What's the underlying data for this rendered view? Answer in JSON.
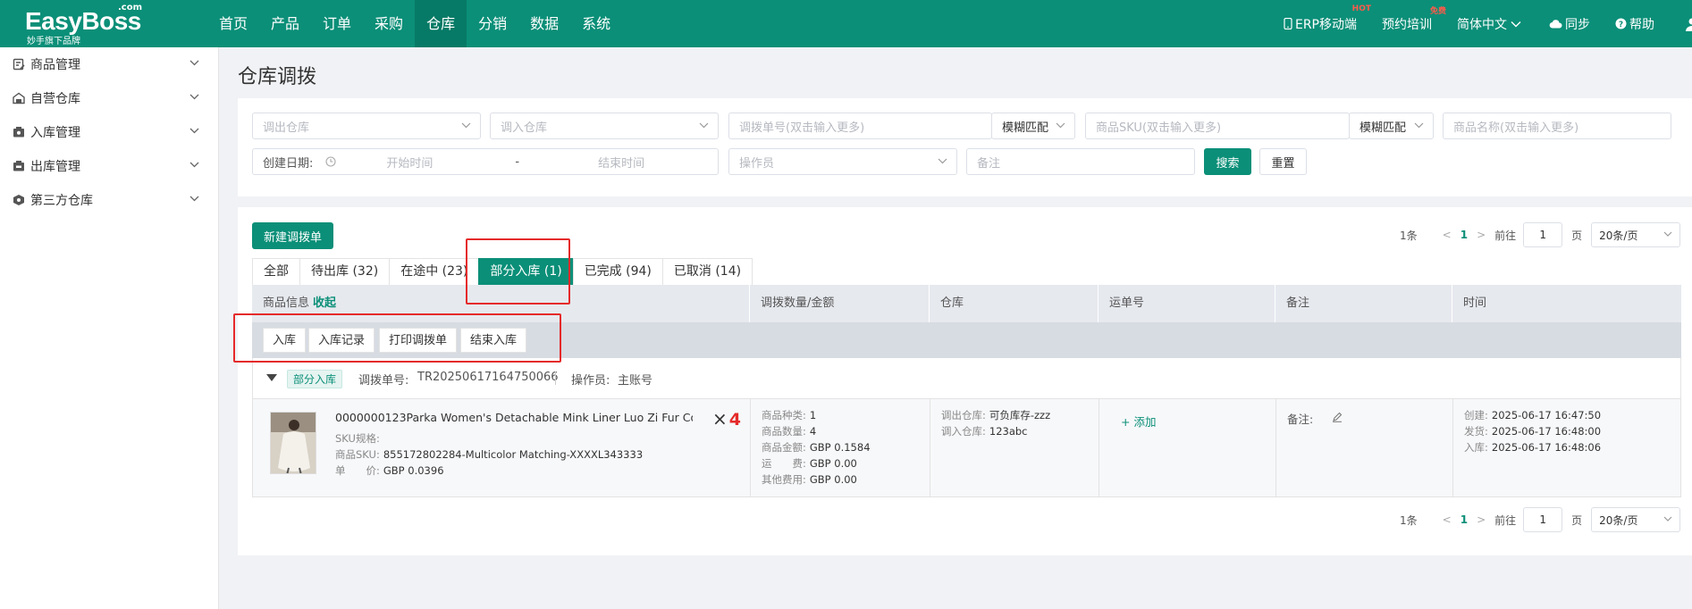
{
  "app": {
    "logo": "EasyBoss",
    "logo_suffix": ".com",
    "logo_sub": "妙手旗下品牌"
  },
  "nav": {
    "items": [
      {
        "label": "首页"
      },
      {
        "label": "产品"
      },
      {
        "label": "订单"
      },
      {
        "label": "采购"
      },
      {
        "label": "仓库",
        "active": true
      },
      {
        "label": "分销"
      },
      {
        "label": "数据"
      },
      {
        "label": "系统"
      }
    ],
    "right": {
      "erp_mobile": "ERP移动端",
      "erp_badge": "HOT",
      "training": "预约培训",
      "training_badge": "免费",
      "language": "简体中文",
      "sync": "同步",
      "help": "帮助"
    }
  },
  "sidebar": {
    "items": [
      {
        "label": "商品管理",
        "icon": "product-icon"
      },
      {
        "label": "自营仓库",
        "icon": "warehouse-icon"
      },
      {
        "label": "入库管理",
        "icon": "inbound-icon"
      },
      {
        "label": "出库管理",
        "icon": "outbound-icon"
      },
      {
        "label": "第三方仓库",
        "icon": "third-party-icon"
      }
    ]
  },
  "page": {
    "title": "仓库调拨"
  },
  "filters": {
    "out_warehouse": "调出仓库",
    "in_warehouse": "调入仓库",
    "transfer_no": "调拨单号(双击输入更多)",
    "transfer_match": "模糊匹配",
    "sku": "商品SKU(双击输入更多)",
    "sku_match": "模糊匹配",
    "product_name": "商品名称(双击输入更多)",
    "created_label": "创建日期:",
    "start_time": "开始时间",
    "date_sep": "-",
    "end_time": "结束时间",
    "operator": "操作员",
    "remark": "备注",
    "search_btn": "搜索",
    "reset_btn": "重置"
  },
  "list": {
    "new_btn": "新建调拨单",
    "tabs": [
      {
        "label": "全部"
      },
      {
        "label": "待出库 (32)"
      },
      {
        "label": "在途中 (23)"
      },
      {
        "label": "部分入库 (1)",
        "active": true
      },
      {
        "label": "已完成 (94)"
      },
      {
        "label": "已取消 (14)"
      }
    ],
    "columns": {
      "product": "商品信息",
      "collapse": "收起",
      "qty_amount": "调拨数量/金额",
      "warehouse": "仓库",
      "tracking": "运单号",
      "remark": "备注",
      "time": "时间"
    },
    "actions": [
      "入库",
      "入库记录",
      "打印调拨单",
      "结束入库"
    ],
    "pager": {
      "total": "1条",
      "prev": "<",
      "page": "1",
      "next": ">",
      "goto": "前往",
      "goto_value": "1",
      "page_unit": "页",
      "page_size": "20条/页"
    },
    "orders": [
      {
        "status": "部分入库",
        "transfer_no_label": "调拨单号:",
        "transfer_no": "TR20250617164750066",
        "operator_label": "操作员:",
        "operator": "主账号",
        "product": {
          "title": "0000000123Parka Women's Detachable Mink Liner Luo Zi Fur Co…",
          "sku_spec_label": "SKU规格:",
          "sku_spec": "",
          "sku_label": "商品SKU:",
          "sku": "855172802284-Multicolor Matching-XXXXL343333",
          "unit_price_label": "单　　价:",
          "unit_price": "GBP 0.0396",
          "multiplier_symbol": "×",
          "multiplier": "4"
        },
        "qty": {
          "kinds_label": "商品种类:",
          "kinds": "1",
          "count_label": "商品数量:",
          "count": "4",
          "amount_label": "商品金额:",
          "amount": "GBP 0.1584",
          "freight_label": "运　　费:",
          "freight": "GBP 0.00",
          "other_label": "其他费用:",
          "other": "GBP 0.00"
        },
        "warehouse": {
          "out_label": "调出仓库:",
          "out": "可负库存-zzz",
          "in_label": "调入仓库:",
          "in": "123abc"
        },
        "tracking_add": "+ 添加",
        "remark_label": "备注:",
        "times": {
          "created_label": "创建:",
          "created": "2025-06-17 16:47:50",
          "shipped_label": "发货:",
          "shipped": "2025-06-17 16:48:00",
          "inbound_label": "入库:",
          "inbound": "2025-06-17 16:48:06"
        }
      }
    ]
  },
  "colors": {
    "brand": "#0b8f78",
    "highlight_box": "#e52a2a",
    "multiplier": "#e52a2a"
  }
}
